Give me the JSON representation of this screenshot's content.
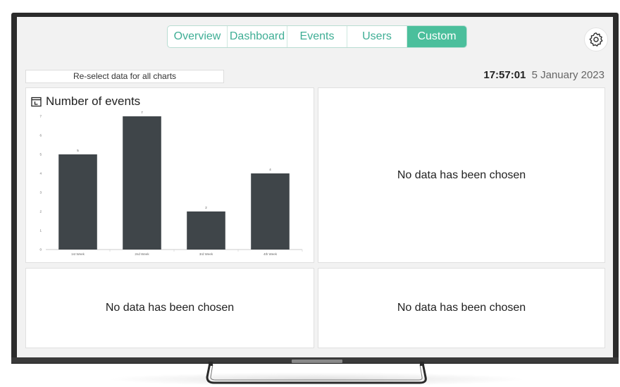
{
  "nav": {
    "tabs": [
      {
        "label": "Overview",
        "active": false
      },
      {
        "label": "Dashboard",
        "active": false
      },
      {
        "label": "Events",
        "active": false
      },
      {
        "label": "Users",
        "active": false
      },
      {
        "label": "Custom",
        "active": true
      }
    ]
  },
  "toolbar": {
    "reselect_label": "Re-select data for all charts",
    "time": "17:57:01",
    "date": "5 January 2023"
  },
  "panels": {
    "chart1_title": "Number of events",
    "empty_message": "No data has been chosen"
  },
  "colors": {
    "accent": "#4bbf9c",
    "bar": "#3f4549"
  },
  "icons": {
    "settings": "gear-icon",
    "chart": "calendar-icon"
  },
  "chart_data": {
    "type": "bar",
    "title": "Number of events",
    "categories": [
      "1st Week",
      "2nd Week",
      "3rd Week",
      "4th Week"
    ],
    "values": [
      5,
      7,
      2,
      4
    ],
    "ylim": [
      0,
      7
    ],
    "yticks": [
      0,
      1,
      2,
      3,
      4,
      5,
      6,
      7
    ],
    "xlabel": "",
    "ylabel": "",
    "grid": false
  }
}
